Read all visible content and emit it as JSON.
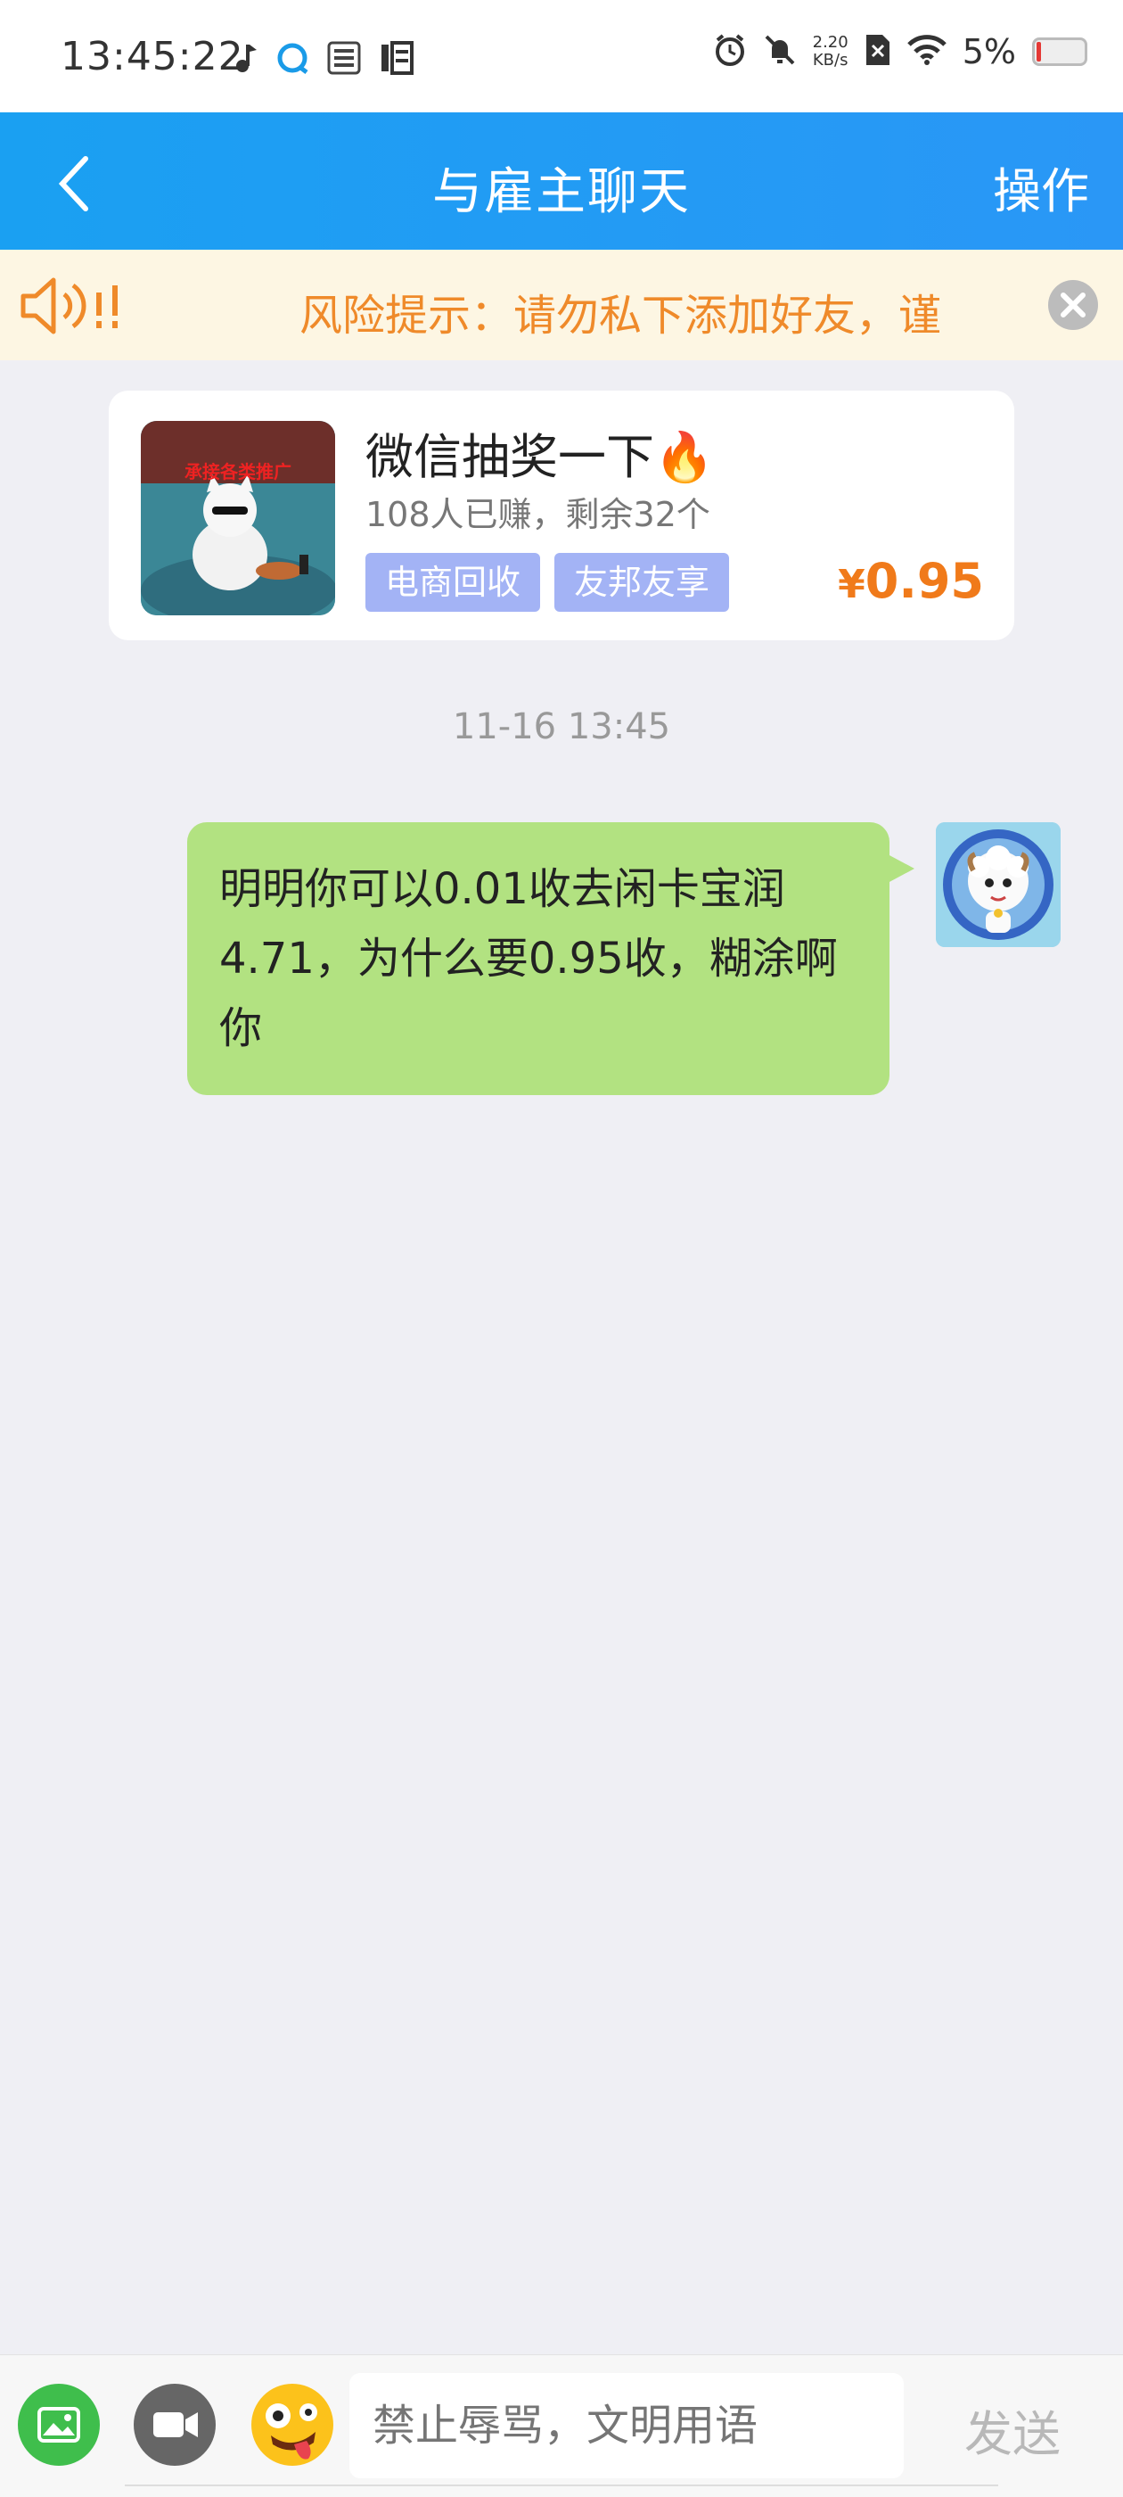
{
  "status_bar": {
    "time": "13:45:22",
    "net_speed": "2.20",
    "net_speed_unit": "KB/s",
    "battery": "5%",
    "left_icons": [
      "music-note-icon",
      "browser-icon",
      "news-icon",
      "hot-icon"
    ],
    "right_icons": [
      "alarm-icon",
      "mute-icon",
      "sim-off-icon",
      "wifi-icon",
      "battery-icon"
    ]
  },
  "header": {
    "title": "与雇主聊天",
    "action": "操作"
  },
  "risk_banner": {
    "text": "风险提示：请勿私下添加好友，谨"
  },
  "task_card": {
    "title": "微信抽奖一下🔥",
    "subtitle": "108人已赚，剩余32个",
    "tags": [
      "电商回收",
      "友邦友享"
    ],
    "price_symbol": "¥",
    "price": "0.95",
    "image_caption": "承接各类推广"
  },
  "chat": {
    "timestamp": "11-16 13:45",
    "message": "明明你可以0.01收去闲卡宝润4.71，为什么要0.95收，糊涂啊你"
  },
  "input_bar": {
    "placeholder": "禁止辱骂，文明用语",
    "send_label": "发送"
  },
  "colors": {
    "header": "#2a97f6",
    "risk_text": "#ef8a2a",
    "bubble": "#b2e281",
    "price": "#f07a1a",
    "tag": "#a3b3f5"
  }
}
